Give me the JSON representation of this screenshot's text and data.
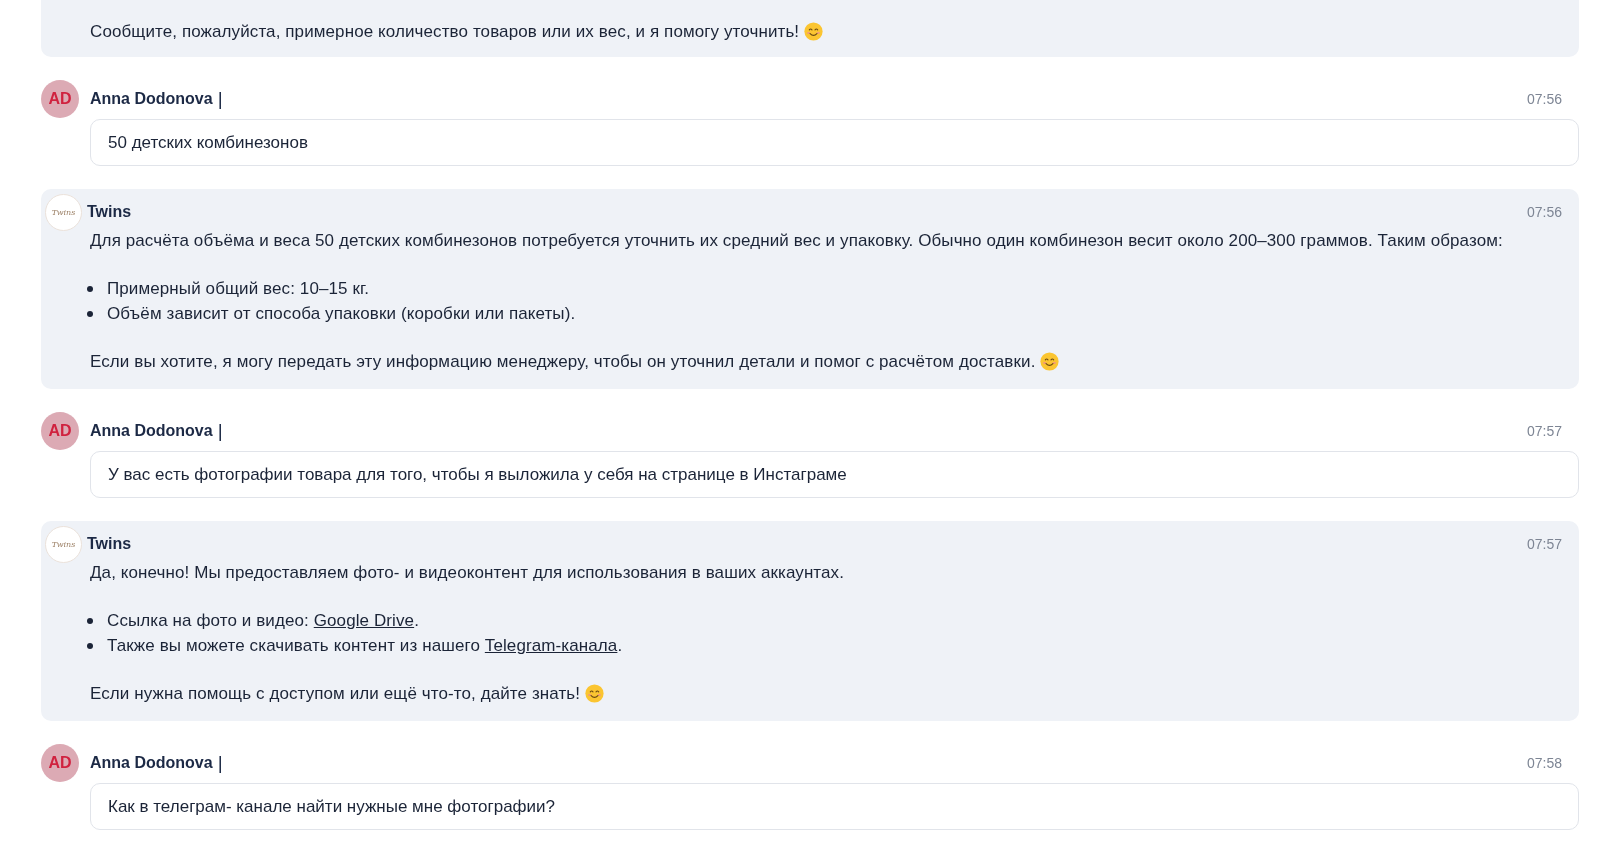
{
  "messages": [
    {
      "kind": "bot",
      "body": [
        {
          "kind": "paragraph",
          "text": "Сообщите, пожалуйста, примерное количество товаров или их вес, и я помогу уточнить!",
          "emoji": true
        }
      ]
    },
    {
      "kind": "user",
      "avatar": {
        "initials": "AD"
      },
      "author": "Anna Dodonova",
      "separator": "|",
      "time": "07:56",
      "text": "50 детских комбинезонов"
    },
    {
      "kind": "bot",
      "avatar": {
        "logo_text": "Twins"
      },
      "author": "Twins",
      "time": "07:56",
      "body": [
        {
          "kind": "paragraph",
          "text": "Для расчёта объёма и веса 50 детских комбинезонов потребуется уточнить их средний вес и упаковку. Обычно один комбинезон весит около 200–300 граммов. Таким образом:",
          "emoji": false
        },
        {
          "kind": "list",
          "items": [
            {
              "parts": [
                {
                  "kind": "text",
                  "text": "Примерный общий вес: 10–15 кг."
                }
              ]
            },
            {
              "parts": [
                {
                  "kind": "text",
                  "text": "Объём зависит от способа упаковки (коробки или пакеты)."
                }
              ]
            }
          ]
        },
        {
          "kind": "paragraph",
          "text": "Если вы хотите, я могу передать эту информацию менеджеру, чтобы он уточнил детали и помог с расчётом доставки.",
          "emoji": true
        }
      ]
    },
    {
      "kind": "user",
      "avatar": {
        "initials": "AD"
      },
      "author": "Anna Dodonova",
      "separator": "|",
      "time": "07:57",
      "text": "У вас есть фотографии товара для того, чтобы я выложила у себя на странице в Инстаграме"
    },
    {
      "kind": "bot",
      "avatar": {
        "logo_text": "Twins"
      },
      "author": "Twins",
      "time": "07:57",
      "body": [
        {
          "kind": "paragraph",
          "text": "Да, конечно! Мы предоставляем фото- и видеоконтент для использования в ваших аккаунтах.",
          "emoji": false
        },
        {
          "kind": "list",
          "items": [
            {
              "parts": [
                {
                  "kind": "text",
                  "text": "Ссылка на фото и видео: "
                },
                {
                  "kind": "link",
                  "text": "Google Drive"
                },
                {
                  "kind": "text",
                  "text": "."
                }
              ]
            },
            {
              "parts": [
                {
                  "kind": "text",
                  "text": "Также вы можете скачивать контент из нашего "
                },
                {
                  "kind": "link",
                  "text": "Telegram-канала"
                },
                {
                  "kind": "text",
                  "text": "."
                }
              ]
            }
          ]
        },
        {
          "kind": "paragraph",
          "text": "Если нужна помощь с доступом или ещё что-то, дайте знать!",
          "emoji": true
        }
      ]
    },
    {
      "kind": "user",
      "avatar": {
        "initials": "AD"
      },
      "author": "Anna Dodonova",
      "separator": "|",
      "time": "07:58",
      "text": "Как в телеграм- канале найти нужные мне фотографии?"
    }
  ]
}
